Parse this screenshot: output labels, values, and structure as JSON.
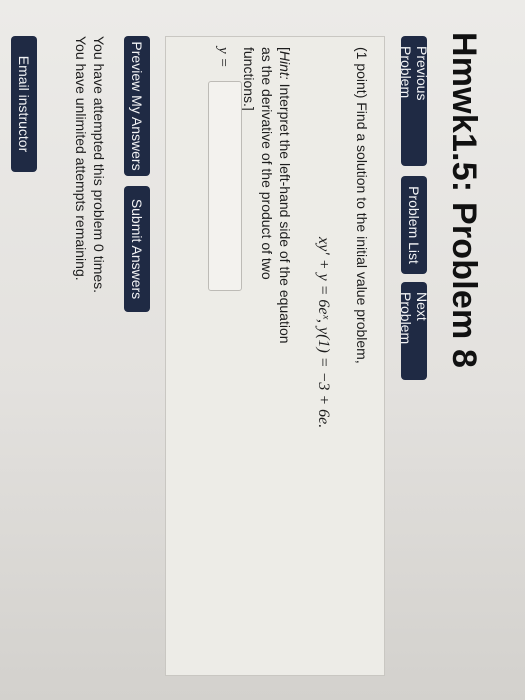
{
  "page_title": "Hmwk1.5: Problem 8",
  "nav": {
    "previous": "Previous Problem",
    "list": "Problem List",
    "next": "Next Problem"
  },
  "problem": {
    "intro": "(1 point) Find a solution to the initial value problem,",
    "equation": "xy′ + y = 6eˣ,   y(1) = −3 + 6e.",
    "hint_label": "Hint:",
    "hint_text": " Interpret the left-hand side of the equation as the derivative of the product of two functions.]",
    "hint_open": "[",
    "answer_label": "y =",
    "answer_value": ""
  },
  "actions": {
    "preview": "Preview My Answers",
    "submit": "Submit Answers"
  },
  "attempts": {
    "line1": "You have attempted this problem 0 times.",
    "line2": "You have unlimited attempts remaining."
  },
  "email_button": "Email instructor",
  "colors": {
    "button_bg": "#1f2a44",
    "button_text": "#f2f3f5"
  }
}
